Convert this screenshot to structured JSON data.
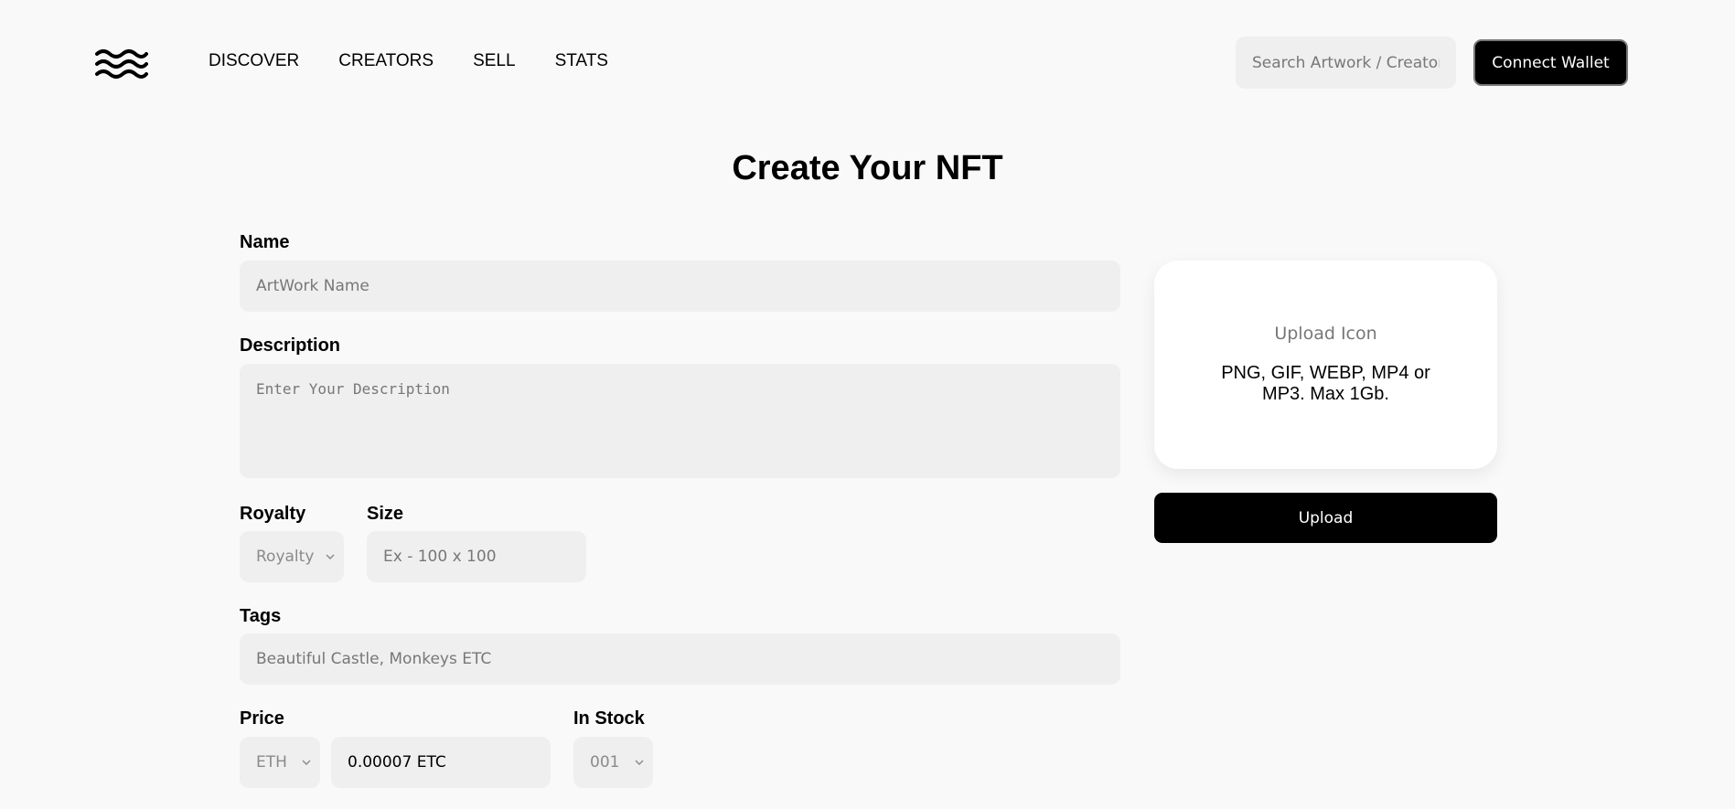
{
  "header": {
    "logo": "waves-logo-icon",
    "nav": [
      "DISCOVER",
      "CREATORS",
      "SELL",
      "STATS"
    ],
    "search_placeholder": "Search Artwork / Creator",
    "connect_label": "Connect Wallet"
  },
  "page": {
    "title": "Create Your NFT"
  },
  "form": {
    "name": {
      "label": "Name",
      "placeholder": "ArtWork Name"
    },
    "description": {
      "label": "Description",
      "placeholder": "Enter Your Description"
    },
    "royalty": {
      "label": "Royalty",
      "selected": "Royalty"
    },
    "size": {
      "label": "Size",
      "placeholder": "Ex - 100 x 100"
    },
    "tags": {
      "label": "Tags",
      "placeholder": "Beautiful Castle, Monkeys ETC"
    },
    "price": {
      "label": "Price",
      "currency": "ETH",
      "value": "0.00007 ETC"
    },
    "in_stock": {
      "label": "In Stock",
      "selected": "001"
    }
  },
  "upload": {
    "icon_label": "Upload Icon",
    "hint": "PNG, GIF, WEBP, MP4 or MP3. Max 1Gb.",
    "button_label": "Upload"
  }
}
